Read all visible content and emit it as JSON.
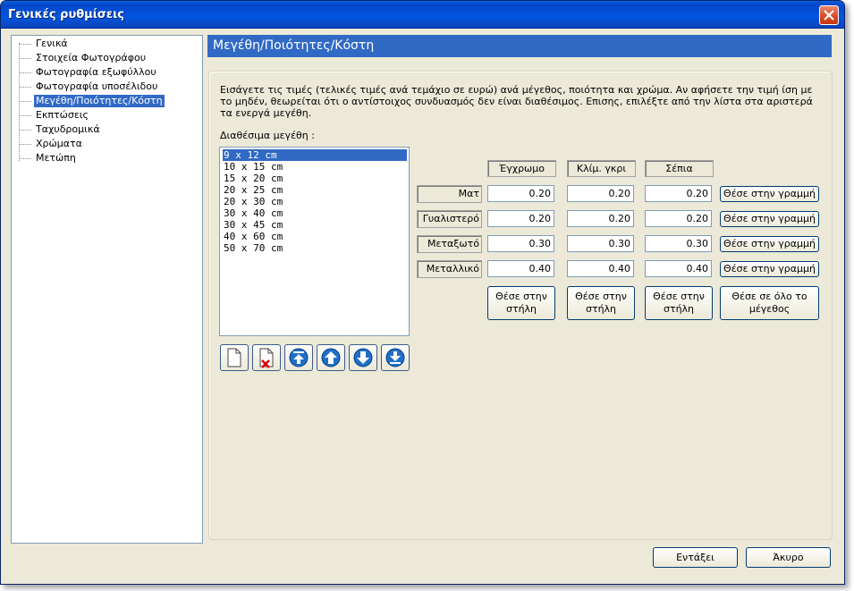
{
  "window": {
    "title": "Γενικές ρυθμίσεις"
  },
  "tree": {
    "items": [
      {
        "label": "Γενικά",
        "selected": false
      },
      {
        "label": "Στοιχεία Φωτογράφου",
        "selected": false
      },
      {
        "label": "Φωτογραφία εξωφύλλου",
        "selected": false
      },
      {
        "label": "Φωτογραφία υποσέλιδου",
        "selected": false
      },
      {
        "label": "Μεγέθη/Ποιότητες/Κόστη",
        "selected": true
      },
      {
        "label": "Εκπτώσεις",
        "selected": false
      },
      {
        "label": "Ταχυδρομικά",
        "selected": false
      },
      {
        "label": "Χρώματα",
        "selected": false
      },
      {
        "label": "Μετώπη",
        "selected": false
      }
    ]
  },
  "section": {
    "title": "Μεγέθη/Ποιότητες/Κόστη",
    "description_line1": "Εισάγετε τις τιμές (τελικές τιμές ανά τεμάχιο σε ευρώ) ανά μέγεθος, ποιότητα και χρώμα. Αν αφήσετε την τιμή ίση με",
    "description_line2": "το μηδέν, θεωρείται ότι ο αντίστοιχος συνδυασμός δεν είναι διαθέσιμος. Επισης, επιλέξτε από την λίστα στα αριστερά",
    "description_line3": "τα ενεργά μεγέθη.",
    "sizes_label": "Διαθέσιμα μεγέθη :"
  },
  "sizes": [
    "9 x 12 cm",
    "10 x 15 cm",
    "15 x 20 cm",
    "20 x 25 cm",
    "20 x 30 cm",
    "30 x 40 cm",
    "30 x 45 cm",
    "40 x 60 cm",
    "50 x 70 cm"
  ],
  "grid": {
    "columns": [
      "Έγχρωμο",
      "Κλίμ. γκρι",
      "Σέπια"
    ],
    "rows": [
      {
        "label": "Ματ",
        "values": [
          "0.20",
          "0.20",
          "0.20"
        ]
      },
      {
        "label": "Γυαλιστερό",
        "values": [
          "0.20",
          "0.20",
          "0.20"
        ]
      },
      {
        "label": "Μεταξωτό",
        "values": [
          "0.30",
          "0.30",
          "0.30"
        ]
      },
      {
        "label": "Μεταλλικό",
        "values": [
          "0.40",
          "0.40",
          "0.40"
        ]
      }
    ],
    "row_button": "Θέσε στην γραμμή",
    "col_button_line1": "Θέσε στην",
    "col_button_line2": "στήλη",
    "all_button_line1": "Θέσε σε όλο το",
    "all_button_line2": "μέγεθος"
  },
  "buttons": {
    "ok": "Εντάξει",
    "cancel": "Άκυρο"
  }
}
